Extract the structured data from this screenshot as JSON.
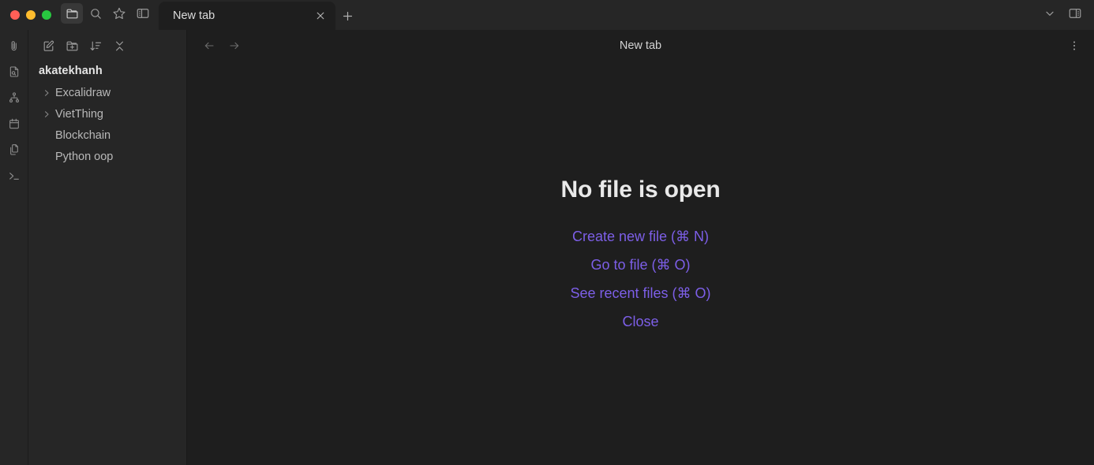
{
  "window": {
    "traffic_lights": [
      {
        "name": "close",
        "color": "#ff5f57"
      },
      {
        "name": "minimize",
        "color": "#febc2e"
      },
      {
        "name": "maximize",
        "color": "#28c840"
      }
    ],
    "toolbar_buttons": [
      {
        "icon": "folder-icon",
        "label": "Files",
        "active": true
      },
      {
        "icon": "search-icon",
        "label": "Search",
        "active": false
      },
      {
        "icon": "star-icon",
        "label": "Bookmarks",
        "active": false
      },
      {
        "icon": "left-sidebar-toggle-icon",
        "label": "Toggle left sidebar",
        "active": false
      }
    ],
    "right_buttons": [
      {
        "icon": "chevron-down-icon",
        "label": "More options"
      },
      {
        "icon": "right-sidebar-toggle-icon",
        "label": "Toggle right sidebar"
      }
    ]
  },
  "tabs": {
    "items": [
      {
        "title": "New tab",
        "active": true,
        "close_label": "Close tab"
      }
    ],
    "new_tab_label": "New tab"
  },
  "ribbon": {
    "items": [
      {
        "icon": "paperclip-icon",
        "label": "Attachments"
      },
      {
        "icon": "file-search-icon",
        "label": "Search in file"
      },
      {
        "icon": "graph-icon",
        "label": "Graph view"
      },
      {
        "icon": "calendar-icon",
        "label": "Daily note"
      },
      {
        "icon": "copy-files-icon",
        "label": "Templates"
      },
      {
        "icon": "terminal-icon",
        "label": "Terminal"
      }
    ]
  },
  "explorer": {
    "toolbar": [
      {
        "icon": "new-note-icon",
        "label": "New note"
      },
      {
        "icon": "new-folder-icon",
        "label": "New folder"
      },
      {
        "icon": "sort-icon",
        "label": "Change sort order"
      },
      {
        "icon": "collapse-all-icon",
        "label": "Collapse all"
      }
    ],
    "vault_name": "akatekhanh",
    "tree": [
      {
        "label": "Excalidraw",
        "type": "folder",
        "expanded": false
      },
      {
        "label": "VietThing",
        "type": "folder",
        "expanded": false
      },
      {
        "label": "Blockchain",
        "type": "file",
        "expanded": false
      },
      {
        "label": "Python oop",
        "type": "file",
        "expanded": false
      }
    ]
  },
  "view": {
    "back_label": "Navigate back",
    "forward_label": "Navigate forward",
    "title": "New tab",
    "more_label": "More options",
    "empty_state": {
      "title": "No file is open",
      "actions": [
        "Create new file (⌘ N)",
        "Go to file (⌘ O)",
        "See recent files (⌘ O)",
        "Close"
      ]
    }
  },
  "colors": {
    "accent": "#7d5fe8",
    "background_primary": "#1e1e1e",
    "background_secondary": "#262626",
    "text_normal": "#dcdcdc",
    "text_muted": "#8e8e8e"
  }
}
